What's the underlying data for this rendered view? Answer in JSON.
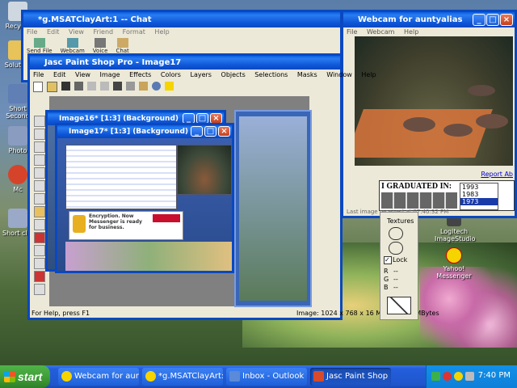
{
  "desktop": {
    "icons": [
      {
        "label": "Recycle"
      },
      {
        "label": "Solution"
      },
      {
        "label": "Short Second"
      },
      {
        "label": "Photo"
      },
      {
        "label": "Mc"
      },
      {
        "label": "Short clip"
      }
    ],
    "right_icons": [
      {
        "label": "Logitech ImageStudio"
      },
      {
        "label": "Yahoo! Messenger"
      }
    ]
  },
  "chat_window": {
    "title": "*g.MSATClayArt:1 -- Chat",
    "menu": [
      "File",
      "Edit",
      "View",
      "Friend",
      "Format",
      "Help"
    ],
    "toolbar": [
      "Send File",
      "Webcam",
      "Voice",
      "Chat"
    ]
  },
  "webcam_window": {
    "title": "Webcam for auntyalias",
    "menu": [
      "File",
      "Webcam",
      "Help"
    ],
    "report_link": "Report Ab",
    "ad_text": "I GRADUATED IN:",
    "years": [
      "1993",
      "1983",
      "1973"
    ],
    "status": "Last image received at 07:40:32 PM"
  },
  "psp_window": {
    "title": "Jasc Paint Shop Pro - Image17",
    "menu": [
      "File",
      "Edit",
      "View",
      "Image",
      "Effects",
      "Colors",
      "Layers",
      "Objects",
      "Selections",
      "Masks",
      "Window",
      "Help"
    ],
    "status_left": "For Help, press F1",
    "status_right": "Image:  1024 x 768 x 16 Million - 2.2 MBytes",
    "image16_title": "Image16* [1:3] (Background)",
    "image17_title": "Image17* [1:3] (Background)",
    "yahoo_notice": "Encryption. Now Messenger is ready for business."
  },
  "color_panel": {
    "textures_label": "Textures",
    "lock_label": "Lock",
    "r_label": "R",
    "g_label": "G",
    "b_label": "B",
    "r_val": "--",
    "g_val": "--",
    "b_val": "--"
  },
  "taskbar": {
    "start_label": "start",
    "buttons": [
      "Webcam for auntyalias",
      "*g.MSATClayArt:1 -- ...",
      "Inbox - Outlook Express",
      "Jasc Paint Shop Pro - ..."
    ],
    "clock": "7:40 PM"
  },
  "colors": {
    "xp_blue": "#0a48c0",
    "taskbar_blue": "#245edb",
    "start_green": "#3c9a35",
    "window_face": "#ece9d8"
  }
}
